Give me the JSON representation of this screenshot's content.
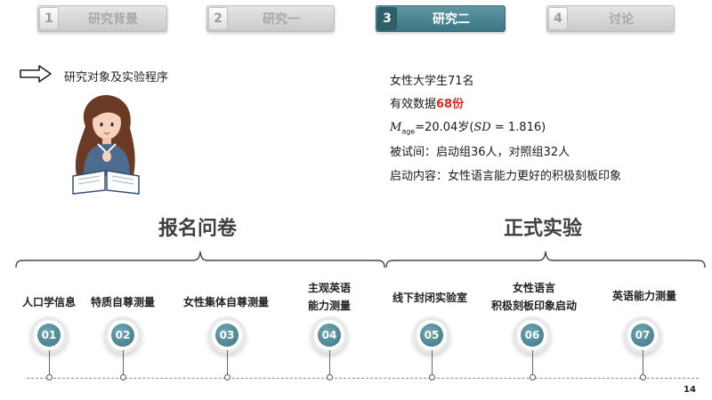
{
  "tabs": [
    {
      "num": "1",
      "label": "研究背景",
      "active": false
    },
    {
      "num": "2",
      "label": "研究一",
      "active": false
    },
    {
      "num": "3",
      "label": "研究二",
      "active": true
    },
    {
      "num": "4",
      "label": "讨论",
      "active": false
    }
  ],
  "section_label": "研究对象及实验程序",
  "info": {
    "line1": "女性大学生71名",
    "line2_prefix": "有效数据",
    "line2_highlight": "68份",
    "line3_m": "M",
    "line3_sub": "age",
    "line3_value": "=20.04岁(",
    "line3_sd": "SD",
    "line3_sd_value": " = 1.816)",
    "line4": "被试间：启动组36人，对照组32人",
    "line5": "启动内容：女性语言能力更好的积极刻板印象"
  },
  "groups": {
    "left_title": "报名问卷",
    "right_title": "正式实验"
  },
  "steps": [
    {
      "num": "01",
      "label": [
        "人口学信息"
      ]
    },
    {
      "num": "02",
      "label": [
        "特质自尊测量"
      ]
    },
    {
      "num": "03",
      "label": [
        "女性集体自尊测量"
      ]
    },
    {
      "num": "04",
      "label": [
        "主观英语",
        "能力测量"
      ]
    },
    {
      "num": "05",
      "label": [
        "线下封闭实验室"
      ]
    },
    {
      "num": "06",
      "label": [
        "女性语言",
        "积极刻板印象启动"
      ]
    },
    {
      "num": "07",
      "label": [
        "英语能力测量"
      ]
    }
  ],
  "page_number": "14",
  "colors": {
    "accent": "#3d7683",
    "highlight": "#e0271f"
  }
}
